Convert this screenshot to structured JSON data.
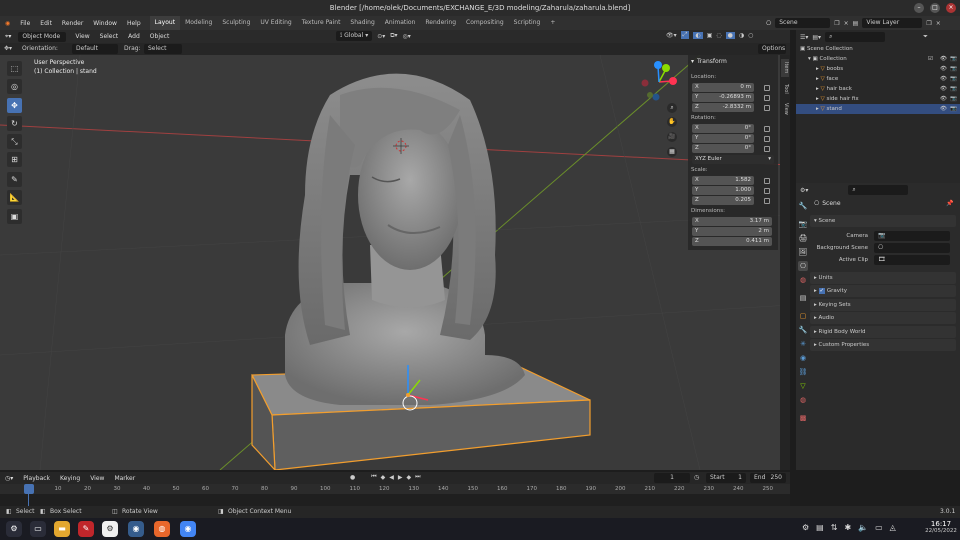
{
  "window": {
    "title": "Blender [/home/olek/Documents/EXCHANGE_E/3D modeling/Zaharula/zaharula.blend]"
  },
  "menus": [
    "File",
    "Edit",
    "Render",
    "Window",
    "Help"
  ],
  "workspaces": [
    "Layout",
    "Modeling",
    "Sculpting",
    "UV Editing",
    "Texture Paint",
    "Shading",
    "Animation",
    "Rendering",
    "Compositing",
    "Scripting"
  ],
  "scene_field": "Scene",
  "view_layer_field": "View Layer",
  "viewport_header": {
    "mode": "Object Mode",
    "items": [
      "View",
      "Select",
      "Add",
      "Object"
    ],
    "orientation_transform": "Global",
    "options": "Options"
  },
  "tool_header": {
    "orientation_label": "Orientation:",
    "orientation_value": "Default",
    "drag_label": "Drag:",
    "drag_value": "Select Box"
  },
  "viewport": {
    "title": "User Perspective",
    "subtitle": "(1) Collection | stand"
  },
  "npanel": {
    "header": "Transform",
    "location_label": "Location:",
    "loc": [
      [
        "X",
        "0 m"
      ],
      [
        "Y",
        "-0.26893 m"
      ],
      [
        "Z",
        "-2.8332 m"
      ]
    ],
    "rotation_label": "Rotation:",
    "rot": [
      [
        "X",
        "0°"
      ],
      [
        "Y",
        "0°"
      ],
      [
        "Z",
        "0°"
      ]
    ],
    "rot_mode": "XYZ Euler",
    "scale_label": "Scale:",
    "scale": [
      [
        "X",
        "1.582"
      ],
      [
        "Y",
        "1.000"
      ],
      [
        "Z",
        "0.205"
      ]
    ],
    "dimensions_label": "Dimensions:",
    "dim": [
      [
        "X",
        "3.17 m"
      ],
      [
        "Y",
        "2 m"
      ],
      [
        "Z",
        "0.411 m"
      ]
    ],
    "tabs": [
      "Item",
      "Tool",
      "View"
    ]
  },
  "outliner": {
    "root": "Scene Collection",
    "collection": "Collection",
    "objects": [
      "boobs",
      "face",
      "hair back",
      "side hair fix",
      "stand"
    ],
    "selected": "stand"
  },
  "properties": {
    "crumb": "Scene",
    "section": "Scene",
    "camera_label": "Camera",
    "bg_label": "Background Scene",
    "clip_label": "Active Clip",
    "subsections": [
      "Units",
      "Gravity",
      "Keying Sets",
      "Audio",
      "Rigid Body World",
      "Custom Properties"
    ]
  },
  "timeline": {
    "menus": [
      "Playback",
      "Keying",
      "View",
      "Marker"
    ],
    "current": "1",
    "start_label": "Start",
    "start": "1",
    "end_label": "End",
    "end": "250",
    "ticks": [
      "1",
      "10",
      "20",
      "30",
      "40",
      "50",
      "60",
      "70",
      "80",
      "90",
      "100",
      "110",
      "120",
      "130",
      "140",
      "150",
      "160",
      "170",
      "180",
      "190",
      "200",
      "210",
      "220",
      "230",
      "240",
      "250"
    ]
  },
  "status": {
    "select": "Select",
    "box_select": "Box Select",
    "rotate": "Rotate View",
    "context": "Object Context Menu",
    "version": "3.0.1"
  },
  "taskbar": {
    "time": "16:17",
    "date": "22/05/2022"
  },
  "colors": {
    "accent": "#4772b3",
    "select_orange": "#f29e2e",
    "axis_x": "#ff3352",
    "axis_y": "#8bdc00",
    "axis_z": "#2890ff"
  }
}
